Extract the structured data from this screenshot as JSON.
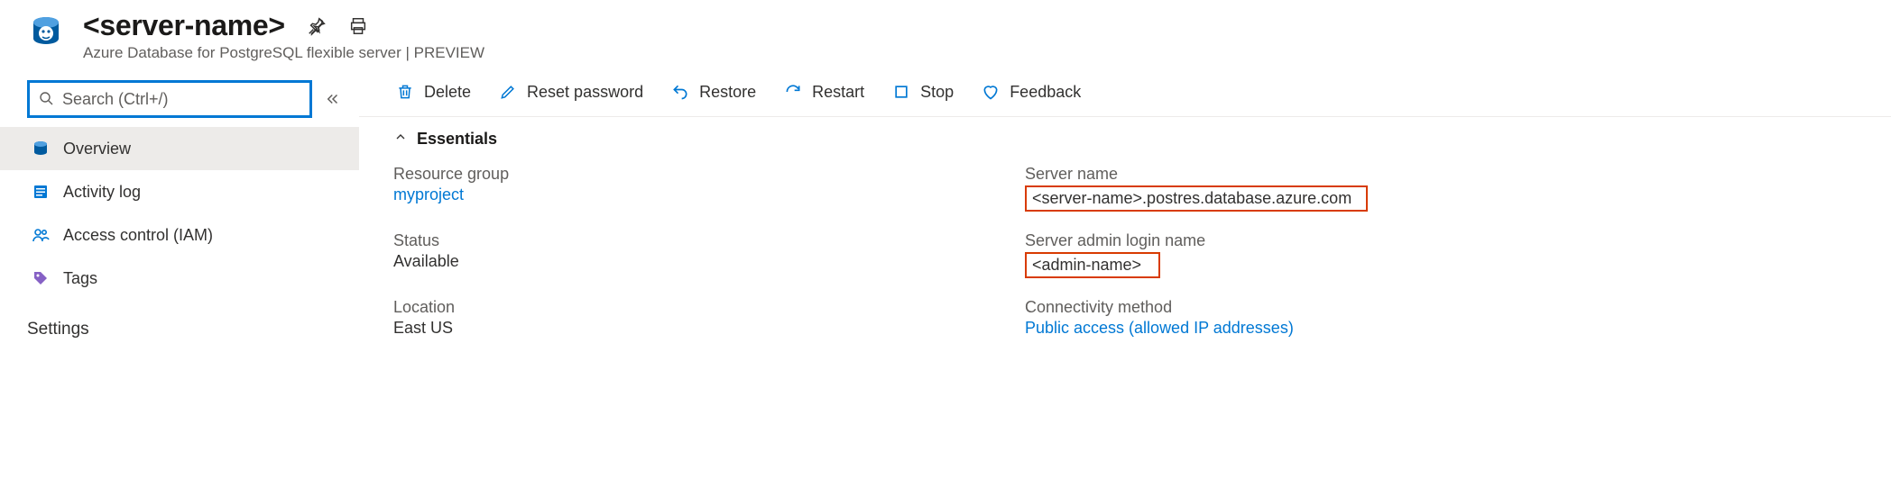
{
  "header": {
    "title": "<server-name>",
    "subtitle": "Azure Database for PostgreSQL flexible server | PREVIEW"
  },
  "search": {
    "placeholder": "Search (Ctrl+/)"
  },
  "sidebar": {
    "items": [
      {
        "label": "Overview"
      },
      {
        "label": "Activity log"
      },
      {
        "label": "Access control (IAM)"
      },
      {
        "label": "Tags"
      }
    ],
    "section": "Settings"
  },
  "toolbar": {
    "delete": "Delete",
    "reset_password": "Reset password",
    "restore": "Restore",
    "restart": "Restart",
    "stop": "Stop",
    "feedback": "Feedback"
  },
  "essentials": {
    "header": "Essentials",
    "left": {
      "resource_group_label": "Resource group",
      "resource_group_value": "myproject",
      "status_label": "Status",
      "status_value": "Available",
      "location_label": "Location",
      "location_value": "East US"
    },
    "right": {
      "server_name_label": "Server name",
      "server_name_value": "<server-name>.postres.database.azure.com",
      "admin_label": "Server admin login name",
      "admin_value": "<admin-name>",
      "connectivity_label": "Connectivity method",
      "connectivity_value": "Public access (allowed IP addresses)"
    }
  }
}
